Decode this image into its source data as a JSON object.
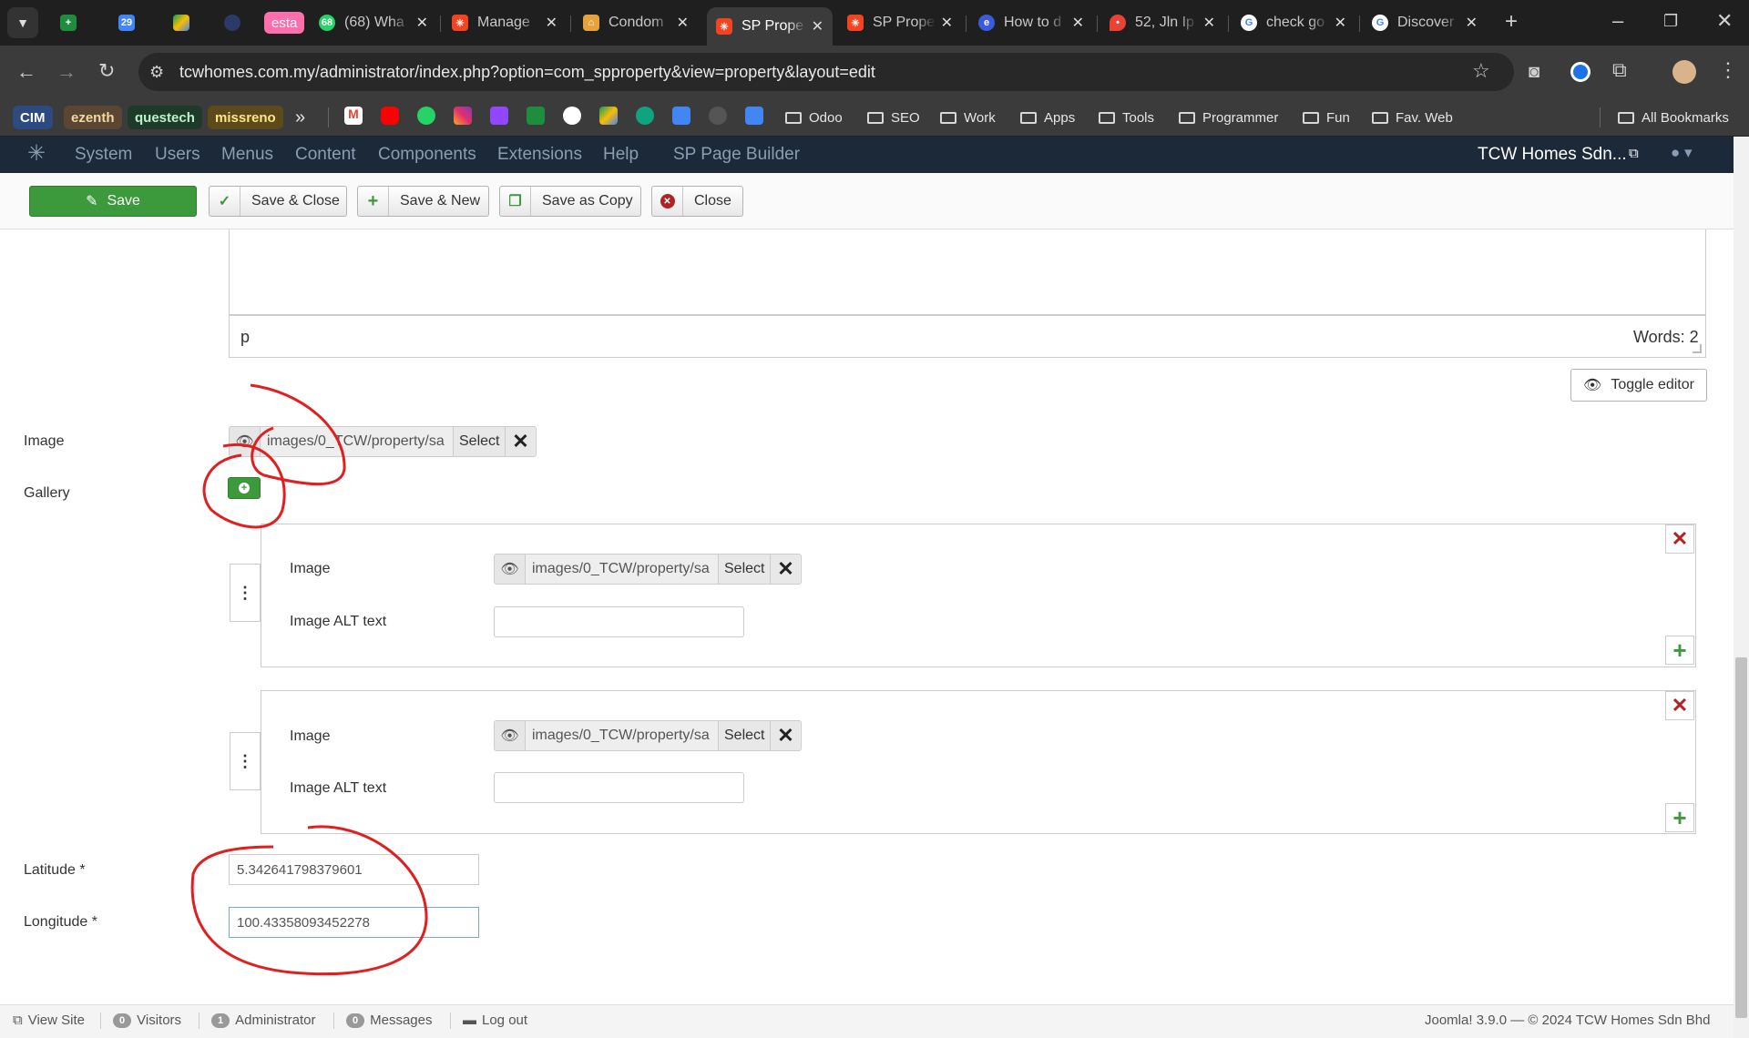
{
  "browser": {
    "tabs": [
      {
        "title": "",
        "icon": "sheets-icon",
        "color": "#1e8e3e"
      },
      {
        "title": "",
        "icon": "calendar-icon",
        "color": "#4285f4"
      },
      {
        "title": "",
        "icon": "drive-icon",
        "color": "#fbbc04"
      },
      {
        "title": "",
        "icon": "app-icon",
        "color": "#2b3a67"
      },
      {
        "title": "esta",
        "icon": "",
        "color": "#ff6fae"
      },
      {
        "title": "(68) Wha",
        "icon": "whatsapp-icon",
        "color": "#25d366"
      },
      {
        "title": "Manage",
        "icon": "joomla-icon",
        "color": "#f44321"
      },
      {
        "title": "Condom",
        "icon": "condo-icon",
        "color": "#e6a23c"
      },
      {
        "title": "SP Prope",
        "icon": "joomla-icon",
        "color": "#f44321"
      },
      {
        "title": "SP Prope",
        "icon": "joomla-icon",
        "color": "#f44321"
      },
      {
        "title": "How to d",
        "icon": "site-icon",
        "color": "#3b5bdb"
      },
      {
        "title": "52, Jln Ip",
        "icon": "maps-icon",
        "color": "#ea4335"
      },
      {
        "title": "check go",
        "icon": "google-icon",
        "color": "#ffffff"
      },
      {
        "title": "Discover",
        "icon": "google-icon",
        "color": "#ffffff"
      }
    ],
    "url": "tcwhomes.com.my/administrator/index.php?option=com_spproperty&view=property&layout=edit",
    "bookmarks_chips": [
      {
        "label": "CIM",
        "bg": "#2d4a80",
        "fg": "#ffffff"
      },
      {
        "label": "ezenth",
        "bg": "#5a4632",
        "fg": "#f3d9a0"
      },
      {
        "label": "questech",
        "bg": "#1e3a2a",
        "fg": "#bff0c8"
      },
      {
        "label": "missreno",
        "bg": "#5c4a1a",
        "fg": "#ffe58a"
      }
    ],
    "bookmark_folders": [
      "Odoo",
      "SEO",
      "Work",
      "Apps",
      "Tools",
      "Programmer",
      "Fun",
      "Fav. Web"
    ],
    "all_bookmarks": "All Bookmarks",
    "more": "»"
  },
  "admin_nav": {
    "items": [
      "System",
      "Users",
      "Menus",
      "Content",
      "Components",
      "Extensions",
      "Help",
      "SP Page Builder"
    ],
    "site_name": "TCW Homes Sdn...",
    "user_icon": "user-icon"
  },
  "toolbar": {
    "save": "Save",
    "save_close": "Save & Close",
    "save_new": "Save & New",
    "save_copy": "Save as Copy",
    "close": "Close"
  },
  "editor": {
    "path": "p",
    "words": "Words: 2",
    "toggle": "Toggle editor"
  },
  "form": {
    "image_label": "Image",
    "image_path": "images/0_TCW/property/sa",
    "select_label": "Select",
    "gallery_label": "Gallery",
    "gallery_items": [
      {
        "image_label": "Image",
        "path": "images/0_TCW/property/sa",
        "select": "Select",
        "alt_label": "Image ALT text",
        "alt_value": ""
      },
      {
        "image_label": "Image",
        "path": "images/0_TCW/property/sa",
        "select": "Select",
        "alt_label": "Image ALT text",
        "alt_value": ""
      }
    ],
    "latitude_label": "Latitude *",
    "latitude_value": "5.342641798379601",
    "longitude_label": "Longitude *",
    "longitude_value": "100.43358093452278"
  },
  "status_bar": {
    "view_site": "View Site",
    "visitors_count": "0",
    "visitors": "Visitors",
    "admin_count": "1",
    "admin": "Administrator",
    "messages_count": "0",
    "messages": "Messages",
    "logout": "Log out",
    "footer": "Joomla! 3.9.0 — © 2024 TCW Homes Sdn Bhd"
  },
  "colors": {
    "accent_green": "#3c9a3c",
    "annotation_red": "#e02020",
    "nav_bg": "#1c2939"
  }
}
